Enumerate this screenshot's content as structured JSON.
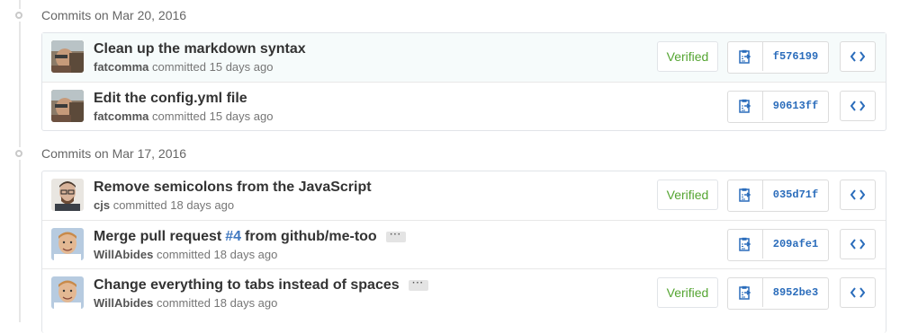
{
  "groups": [
    {
      "date_label": "Commits on Mar 20, 2016",
      "commits": [
        {
          "message": "Clean up the markdown syntax",
          "author": "fatcomma",
          "time": "committed 15 days ago",
          "verified_label": "Verified",
          "sha": "f576199",
          "avatar": "fatcomma-avatar"
        },
        {
          "message": "Edit the config.yml file",
          "author": "fatcomma",
          "time": "committed 15 days ago",
          "sha": "90613ff",
          "avatar": "fatcomma-avatar"
        }
      ]
    },
    {
      "date_label": "Commits on Mar 17, 2016",
      "commits": [
        {
          "message": "Remove semicolons from the JavaScript",
          "author": "cjs",
          "time": "committed 18 days ago",
          "verified_label": "Verified",
          "sha": "035d71f",
          "avatar": "cjs-avatar"
        },
        {
          "message_prefix": "Merge pull request",
          "pr_link": "#4",
          "message_suffix": "from github/me-too",
          "author": "WillAbides",
          "time": "committed 18 days ago",
          "sha": "209afe1",
          "avatar": "willabides-avatar"
        },
        {
          "message": "Change everything to tabs instead of spaces",
          "author": "WillAbides",
          "time": "committed 18 days ago",
          "verified_label": "Verified",
          "sha": "8952be3",
          "avatar": "willabides-avatar"
        }
      ]
    }
  ],
  "ellipsis_label": "···",
  "colors": {
    "verified_green": "#55a532",
    "sha_blue": "#2a6cbb",
    "link_blue": "#4078c0",
    "row_highlight": "#f6fbfb"
  },
  "icons": {
    "copy": "clippy-icon",
    "browse": "code-icon",
    "timeline": "git-commit-icon"
  }
}
